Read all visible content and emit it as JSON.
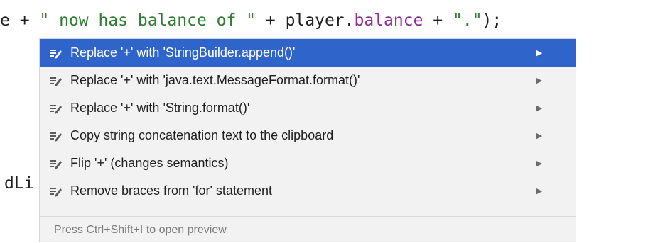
{
  "editor": {
    "line1": {
      "t1": "e + ",
      "t2": "\" now has balance of \"",
      "t3": " + player.",
      "t4": "balance",
      "t5": " + ",
      "t6": "\".\"",
      "t7": ");"
    },
    "line2": {
      "t1": "dLi"
    }
  },
  "popup": {
    "items": [
      {
        "label": "Replace '+' with 'StringBuilder.append()'",
        "icon": "intention-icon",
        "selected": true
      },
      {
        "label": "Replace '+' with 'java.text.MessageFormat.format()'",
        "icon": "intention-icon",
        "selected": false
      },
      {
        "label": "Replace '+' with 'String.format()'",
        "icon": "intention-icon",
        "selected": false
      },
      {
        "label": "Copy string concatenation text to the clipboard",
        "icon": "intention-icon",
        "selected": false
      },
      {
        "label": "Flip '+' (changes semantics)",
        "icon": "intention-icon",
        "selected": false
      },
      {
        "label": "Remove braces from 'for' statement",
        "icon": "intention-icon",
        "selected": false
      }
    ],
    "footer_hint": "Press Ctrl+Shift+I to open preview"
  },
  "colors": {
    "selection": "#2f65ca",
    "string": "#2f7d32",
    "field": "#8a2e93",
    "popup_bg": "#f2f2f2"
  }
}
